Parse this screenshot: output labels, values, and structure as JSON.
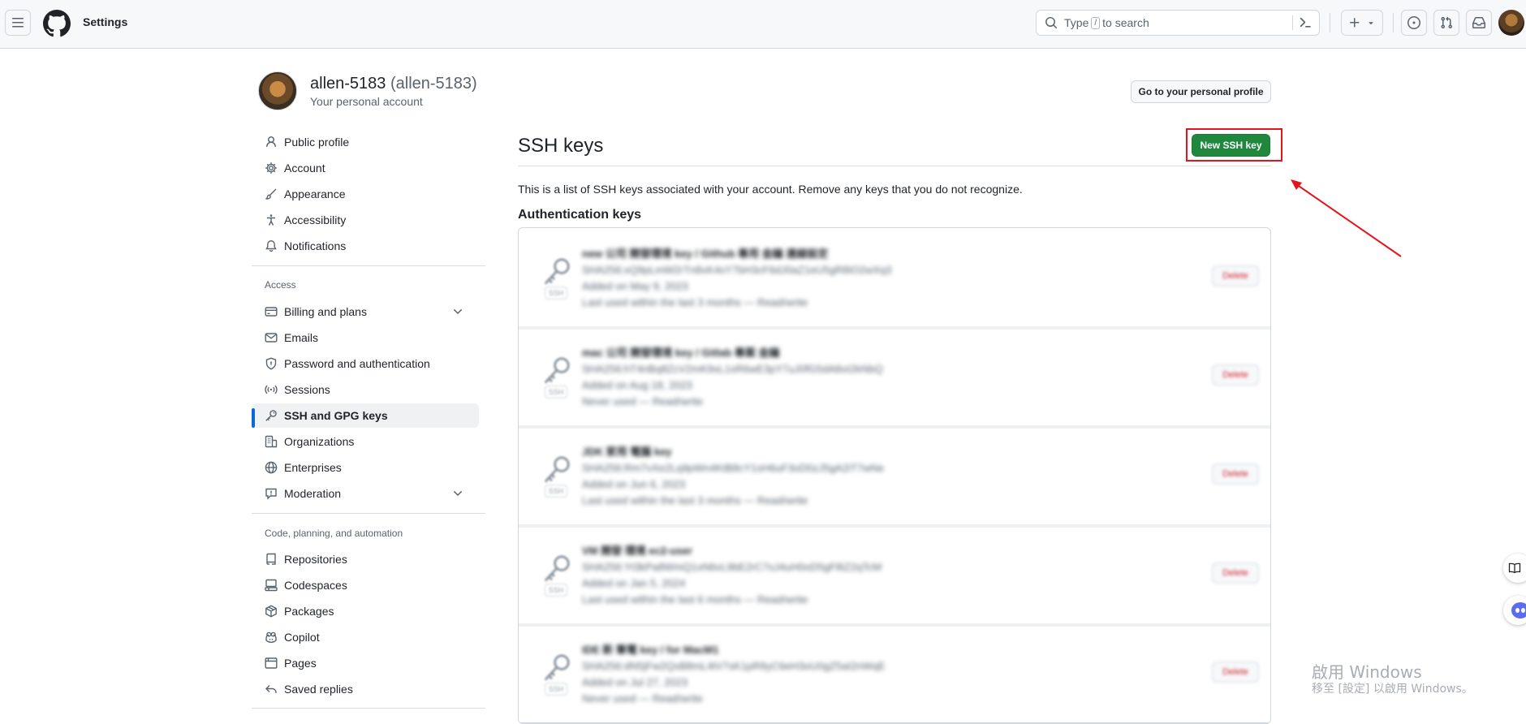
{
  "header": {
    "context_title": "Settings",
    "search_before_kbd": "Type",
    "search_kbd": "/",
    "search_after_kbd": "to search"
  },
  "profile": {
    "display_name": "allen-5183",
    "login": "(allen-5183)",
    "subtitle": "Your personal account",
    "profile_button": "Go to your personal profile"
  },
  "sidebar": {
    "items_top": [
      {
        "label": "Public profile",
        "icon": "person-icon"
      },
      {
        "label": "Account",
        "icon": "gear-icon"
      },
      {
        "label": "Appearance",
        "icon": "paintbrush-icon"
      },
      {
        "label": "Accessibility",
        "icon": "accessibility-icon"
      },
      {
        "label": "Notifications",
        "icon": "bell-icon"
      }
    ],
    "group_access": "Access",
    "items_access": [
      {
        "label": "Billing and plans",
        "icon": "credit-card-icon",
        "expandable": true
      },
      {
        "label": "Emails",
        "icon": "mail-icon"
      },
      {
        "label": "Password and authentication",
        "icon": "shield-lock-icon"
      },
      {
        "label": "Sessions",
        "icon": "broadcast-icon"
      },
      {
        "label": "SSH and GPG keys",
        "icon": "key-icon",
        "active": true
      },
      {
        "label": "Organizations",
        "icon": "organization-icon"
      },
      {
        "label": "Enterprises",
        "icon": "globe-icon"
      },
      {
        "label": "Moderation",
        "icon": "report-icon",
        "expandable": true
      }
    ],
    "group_code": "Code, planning, and automation",
    "items_code": [
      {
        "label": "Repositories",
        "icon": "repo-icon"
      },
      {
        "label": "Codespaces",
        "icon": "codespaces-icon"
      },
      {
        "label": "Packages",
        "icon": "package-icon"
      },
      {
        "label": "Copilot",
        "icon": "copilot-icon"
      },
      {
        "label": "Pages",
        "icon": "browser-icon"
      },
      {
        "label": "Saved replies",
        "icon": "reply-icon"
      }
    ]
  },
  "main": {
    "title": "SSH keys",
    "new_button": "New SSH key",
    "description": "This is a list of SSH keys associated with your account. Remove any keys that you do not recognize.",
    "auth_heading": "Authentication keys"
  },
  "windows_watermark": {
    "line1": "啟用 Windows",
    "line2": "移至 [設定] 以啟用 Windows。"
  },
  "colors": {
    "primary_button": "#1f883d",
    "active_indicator": "#0969da",
    "annotation_red": "#e5131a"
  }
}
